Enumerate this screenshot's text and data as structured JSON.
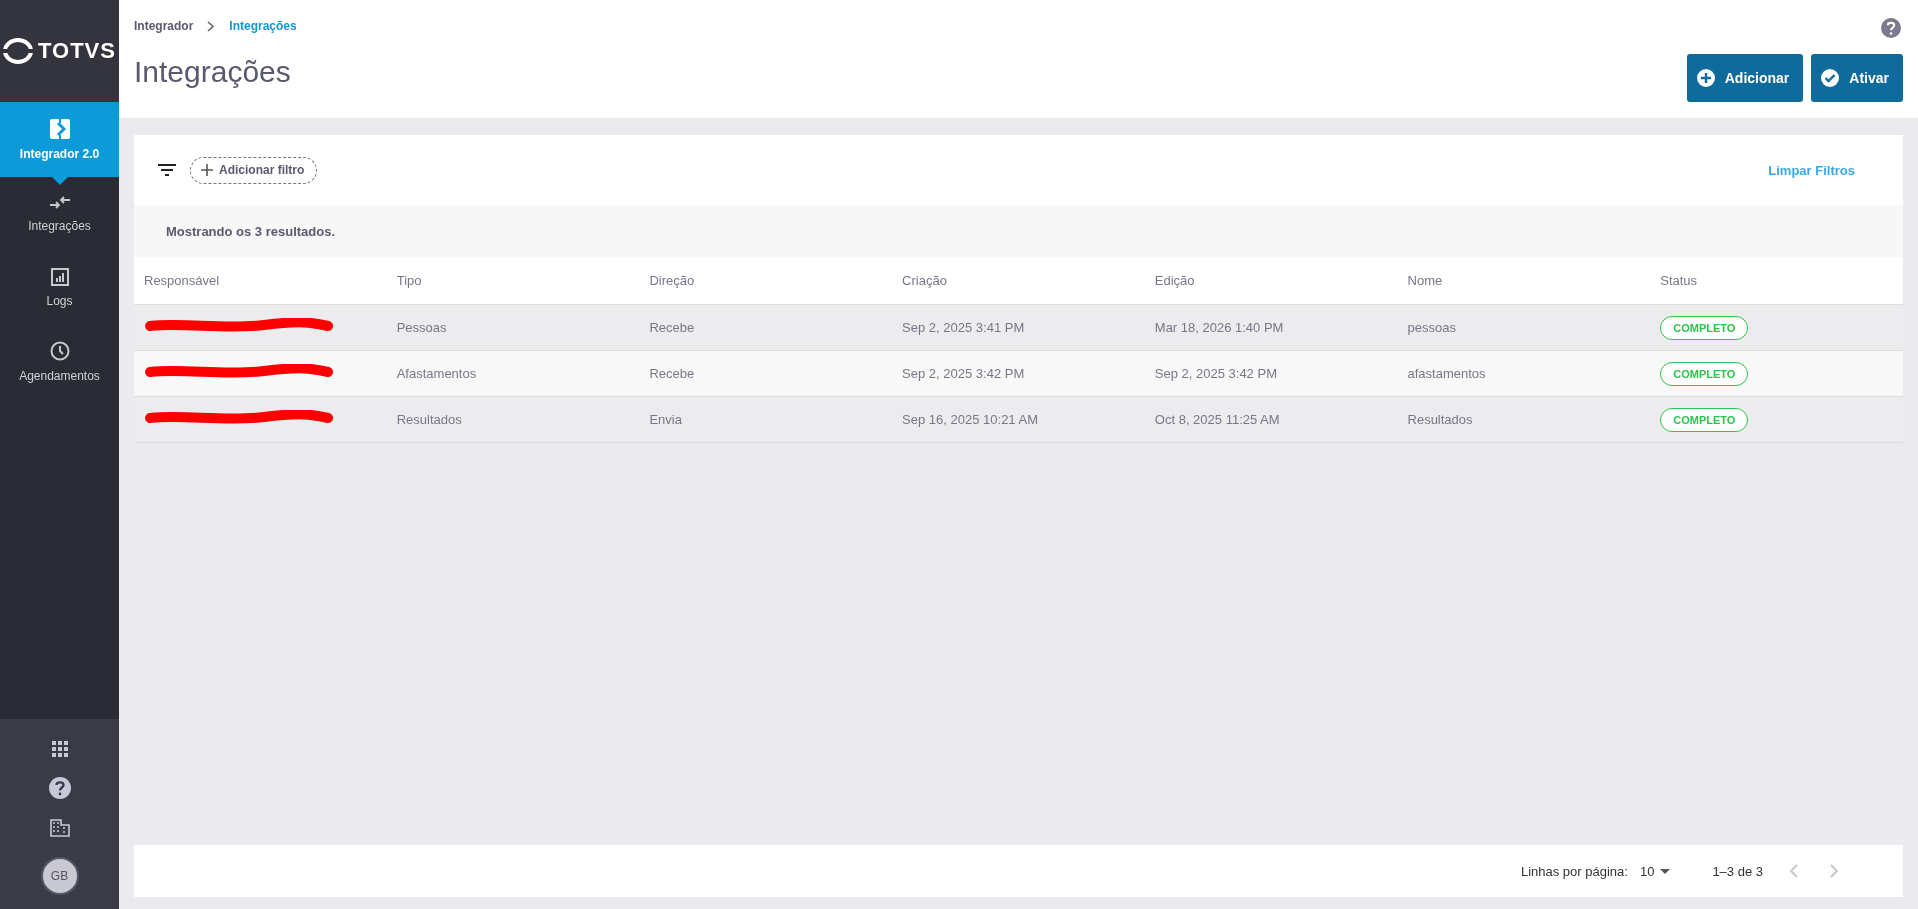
{
  "sidebar": {
    "logo": "TOTVS",
    "items": [
      {
        "label": "Integrador 2.0",
        "selected": true
      },
      {
        "label": "Integrações",
        "selected": false
      },
      {
        "label": "Logs",
        "selected": false
      },
      {
        "label": "Agendamentos",
        "selected": false
      }
    ],
    "bottom": [
      {
        "kind": "apps"
      },
      {
        "kind": "help"
      },
      {
        "kind": "building"
      },
      {
        "kind": "avatar",
        "initials": "GB"
      }
    ]
  },
  "breadcrumb": [
    {
      "label": "Integrador",
      "current": false
    },
    {
      "label": "Integrações",
      "current": true
    }
  ],
  "title": "Integrações",
  "actions": [
    {
      "label": "Adicionar"
    },
    {
      "label": "Ativar"
    }
  ],
  "filters": {
    "add_label": "Adicionar filtro",
    "clear_label": "Limpar Filtros"
  },
  "results_text": "Mostrando os 3 resultados.",
  "table": {
    "columns": [
      "Responsável",
      "Tipo",
      "Direção",
      "Criação",
      "Edição",
      "Nome",
      "Status"
    ],
    "rows": [
      {
        "responsavel_redacted": true,
        "tipo": "Pessoas",
        "direcao": "Recebe",
        "criacao": "Sep 2, 2025 3:41 PM",
        "edicao": "Mar 18, 2026 1:40 PM",
        "nome": "pessoas",
        "status": "COMPLETO"
      },
      {
        "responsavel_redacted": true,
        "tipo": "Afastamentos",
        "direcao": "Recebe",
        "criacao": "Sep 2, 2025 3:42 PM",
        "edicao": "Sep 2, 2025 3:42 PM",
        "nome": "afastamentos",
        "status": "COMPLETO"
      },
      {
        "responsavel_redacted": true,
        "tipo": "Resultados",
        "direcao": "Envia",
        "criacao": "Sep 16, 2025 10:21 AM",
        "edicao": "Oct 8, 2025 11:25 AM",
        "nome": "Resultados",
        "status": "COMPLETO"
      }
    ]
  },
  "pagination": {
    "rows_label": "Linhas por página:",
    "page_size": "10",
    "range": "1–3 de 3",
    "prev_disabled": true,
    "next_disabled": true
  }
}
